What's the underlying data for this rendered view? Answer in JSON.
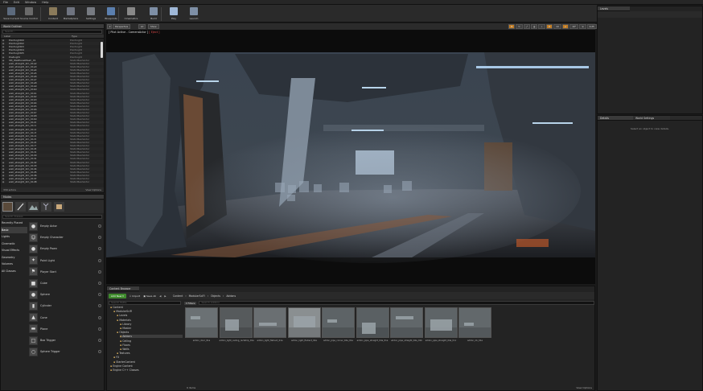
{
  "menu": [
    "File",
    "Edit",
    "Window",
    "Help"
  ],
  "toolbar": {
    "buttons": [
      {
        "label": "Save Current",
        "icon": "save-icon",
        "color": "#5c6a7d"
      },
      {
        "label": "Source Control",
        "icon": "source-control-icon",
        "color": "#6a6a6a"
      },
      {
        "label": "Content",
        "icon": "content-icon",
        "color": "#8a7a5a"
      },
      {
        "label": "Marketplace",
        "icon": "marketplace-icon",
        "color": "#6f7480"
      },
      {
        "label": "Settings",
        "icon": "gear-icon",
        "color": "#777b82"
      },
      {
        "label": "Blueprints",
        "icon": "blueprint-icon",
        "color": "#5b7fae"
      },
      {
        "label": "Cinematics",
        "icon": "cinematics-icon",
        "color": "#888"
      },
      {
        "label": "Build",
        "icon": "build-icon",
        "color": "#7e8fa6"
      },
      {
        "label": "Play",
        "icon": "play-icon",
        "color": "#9fb8d8"
      },
      {
        "label": "Launch",
        "icon": "launch-icon",
        "color": "#7e8fa6"
      }
    ]
  },
  "outliner": {
    "tab": "World Outliner",
    "search_placeholder": "Search...",
    "col_label": "Label",
    "col_type": "Type",
    "rows": [
      {
        "name": "PointLight00",
        "type": "PointLight"
      },
      {
        "name": "PointLight02",
        "type": "PointLight"
      },
      {
        "name": "PointLight03",
        "type": "PointLight"
      },
      {
        "name": "PointLight04",
        "type": "PointLight"
      },
      {
        "name": "PointLight05",
        "type": "PointLight"
      },
      {
        "name": "PostLight",
        "type": "PointLight"
      },
      {
        "name": "SM_WallPanelMesh_01",
        "type": "StaticMeshActor"
      },
      {
        "name": "wall_straight_4m_01a2",
        "type": "StaticMeshActor"
      },
      {
        "name": "wall_straight_4m_01a3",
        "type": "StaticMeshActor"
      },
      {
        "name": "wall_straight_4m_01a4",
        "type": "StaticMeshActor"
      },
      {
        "name": "wall_straight_4m_01a5",
        "type": "StaticMeshActor"
      },
      {
        "name": "wall_straight_4m_01a6",
        "type": "StaticMeshActor"
      },
      {
        "name": "wall_straight_4m_01a7",
        "type": "StaticMeshActor"
      },
      {
        "name": "wall_straight_4m_01a8",
        "type": "StaticMeshActor"
      },
      {
        "name": "wall_straight_4m_01a9",
        "type": "StaticMeshActor"
      },
      {
        "name": "wall_straight_4m_01b0",
        "type": "StaticMeshActor"
      },
      {
        "name": "wall_straight_4m_01b1",
        "type": "StaticMeshActor"
      },
      {
        "name": "wall_straight_4m_01b2",
        "type": "StaticMeshActor"
      },
      {
        "name": "wall_straight_4m_01b3",
        "type": "StaticMeshActor"
      },
      {
        "name": "wall_straight_4m_01b4",
        "type": "StaticMeshActor"
      },
      {
        "name": "wall_straight_4m_01b5",
        "type": "StaticMeshActor"
      },
      {
        "name": "wall_straight_4m_01b6",
        "type": "StaticMeshActor"
      },
      {
        "name": "wall_straight_4m_01b7",
        "type": "StaticMeshActor"
      },
      {
        "name": "wall_straight_4m_01b8",
        "type": "StaticMeshActor"
      },
      {
        "name": "wall_straight_4m_01b9",
        "type": "StaticMeshActor"
      },
      {
        "name": "wall_straight_4m_01c0",
        "type": "StaticMeshActor"
      },
      {
        "name": "wall_straight_4m_01c1",
        "type": "StaticMeshActor"
      },
      {
        "name": "wall_straight_4m_01c2",
        "type": "StaticMeshActor"
      },
      {
        "name": "wall_straight_4m_01c3",
        "type": "StaticMeshActor"
      },
      {
        "name": "wall_straight_4m_01c4",
        "type": "StaticMeshActor"
      },
      {
        "name": "wall_straight_4m_01c5",
        "type": "StaticMeshActor"
      },
      {
        "name": "wall_straight_4m_01c6",
        "type": "StaticMeshActor"
      },
      {
        "name": "wall_straight_4m_01c7",
        "type": "StaticMeshActor"
      },
      {
        "name": "wall_straight_4m_01c8",
        "type": "StaticMeshActor"
      },
      {
        "name": "wall_straight_4m_01c9",
        "type": "StaticMeshActor"
      },
      {
        "name": "wall_straight_4m_01d0",
        "type": "StaticMeshActor"
      },
      {
        "name": "wall_straight_4m_01d1",
        "type": "StaticMeshActor"
      },
      {
        "name": "wall_straight_4m_01d2",
        "type": "StaticMeshActor"
      },
      {
        "name": "wall_straight_4m_01d3",
        "type": "StaticMeshActor"
      },
      {
        "name": "wall_straight_4m_01d4",
        "type": "StaticMeshActor"
      },
      {
        "name": "wall_straight_4m_01d5",
        "type": "StaticMeshActor"
      },
      {
        "name": "wall_straight_4m_01d6",
        "type": "StaticMeshActor"
      },
      {
        "name": "wall_straight_4m_01d7",
        "type": "StaticMeshActor"
      },
      {
        "name": "wall_straight_4m_01d8",
        "type": "StaticMeshActor"
      }
    ],
    "footer_count": "330 actors",
    "footer_view": "View Options"
  },
  "modes": {
    "tab": "Modes",
    "search_placeholder": "Search Classes",
    "categories": [
      "Recently Placed",
      "Basic",
      "Lights",
      "Cinematic",
      "Visual Effects",
      "Geometry",
      "Volumes",
      "All Classes"
    ],
    "selected_category": "Basic",
    "items": [
      {
        "label": "Empty Actor",
        "glyph": "●"
      },
      {
        "label": "Empty Character",
        "glyph": "☺"
      },
      {
        "label": "Empty Pawn",
        "glyph": "●"
      },
      {
        "label": "Point Light",
        "glyph": "✦"
      },
      {
        "label": "Player Start",
        "glyph": "⚑"
      },
      {
        "label": "Cube",
        "glyph": "■"
      },
      {
        "label": "Sphere",
        "glyph": "●"
      },
      {
        "label": "Cylinder",
        "glyph": "▮"
      },
      {
        "label": "Cone",
        "glyph": "▲"
      },
      {
        "label": "Plane",
        "glyph": "▬"
      },
      {
        "label": "Box Trigger",
        "glyph": "□"
      },
      {
        "label": "Sphere Trigger",
        "glyph": "○"
      }
    ]
  },
  "viewport": {
    "btn_perspective": "Perspective",
    "btn_lit": "Lit",
    "btn_show": "Show",
    "pilot_label": "[ Pilot Active - CameraActor ]",
    "pilot_eject": "[ Eject ]",
    "grid_value": "10",
    "rot_value": "10°",
    "scale_value": "0.25",
    "cam_speed": "4"
  },
  "right_panels": {
    "levels_tab": "Levels",
    "details_tab": "Details",
    "world_settings_tab": "World Settings",
    "details_empty": "Select an object to view details."
  },
  "content_browser": {
    "tab": "Content Browser",
    "add_new": "Add New",
    "import": "Import",
    "save_all": "Save All",
    "crumbs": [
      "Content",
      "ModularSciFi",
      "Objects",
      "Addons"
    ],
    "search_paths_placeholder": "Search Paths",
    "filters": "Filters",
    "search_placeholder": "Search Addons",
    "tree": [
      {
        "label": "Content",
        "indent": 0
      },
      {
        "label": "ModularSciFi",
        "indent": 1
      },
      {
        "label": "Levels",
        "indent": 2
      },
      {
        "label": "Materials",
        "indent": 2
      },
      {
        "label": "Library",
        "indent": 3
      },
      {
        "label": "Master",
        "indent": 3
      },
      {
        "label": "Objects",
        "indent": 2
      },
      {
        "label": "Addons",
        "indent": 3,
        "selected": true
      },
      {
        "label": "Ceiling",
        "indent": 3
      },
      {
        "label": "Floors",
        "indent": 3
      },
      {
        "label": "Walls",
        "indent": 3
      },
      {
        "label": "Textures",
        "indent": 2
      },
      {
        "label": "FX",
        "indent": 1
      },
      {
        "label": "StarterContent",
        "indent": 1
      },
      {
        "label": "Engine Content",
        "indent": 0
      },
      {
        "label": "Engine C++ Classes",
        "indent": 0
      }
    ],
    "assets": [
      {
        "caption": "addon_door_01a",
        "tone": "#6b7174"
      },
      {
        "caption": "addon_light_ceiling_rectstrip_01a",
        "tone": "#565a5c"
      },
      {
        "caption": "addon_light_flatrect_01a",
        "tone": "#6a6f72"
      },
      {
        "caption": "addon_light_flatrect_02a",
        "tone": "#8a8f91"
      },
      {
        "caption": "addon_pipe_corner_04a_01a",
        "tone": "#5d6366"
      },
      {
        "caption": "addon_pipe_straight_04a_01a",
        "tone": "#5a6063"
      },
      {
        "caption": "addon_pipe_straight_04a_01b",
        "tone": "#61676a"
      },
      {
        "caption": "addon_pipe_straight_04a_01c",
        "tone": "#5e6467"
      },
      {
        "caption": "addon_rib_01a",
        "tone": "#62686b"
      }
    ],
    "item_count": "9 items",
    "view_options": "View Options"
  }
}
